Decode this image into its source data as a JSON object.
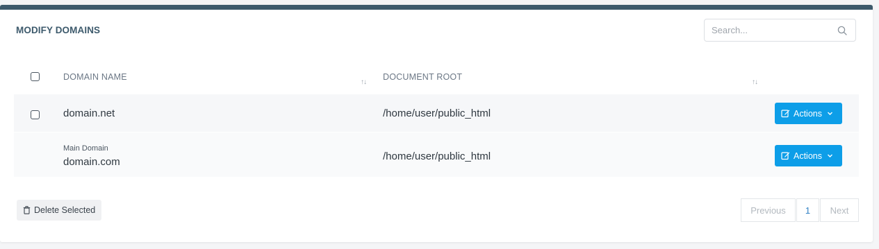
{
  "panel": {
    "title": "MODIFY DOMAINS",
    "search_placeholder": "Search..."
  },
  "table": {
    "columns": [
      "DOMAIN NAME",
      "DOCUMENT ROOT"
    ],
    "sort_glyph": "↑↓",
    "rows": [
      {
        "label": "",
        "domain": "domain.net",
        "root": "/home/user/public_html",
        "action": "Actions",
        "checkbox": true
      },
      {
        "label": "Main Domain",
        "domain": "domain.com",
        "root": "/home/user/public_html",
        "action": "Actions",
        "checkbox": false
      }
    ]
  },
  "footer": {
    "delete_label": "Delete Selected",
    "pagination": {
      "previous": "Previous",
      "current": "1",
      "next": "Next"
    }
  },
  "colors": {
    "accent": "#0d9ee8",
    "header_bar": "#3d5a6c"
  }
}
